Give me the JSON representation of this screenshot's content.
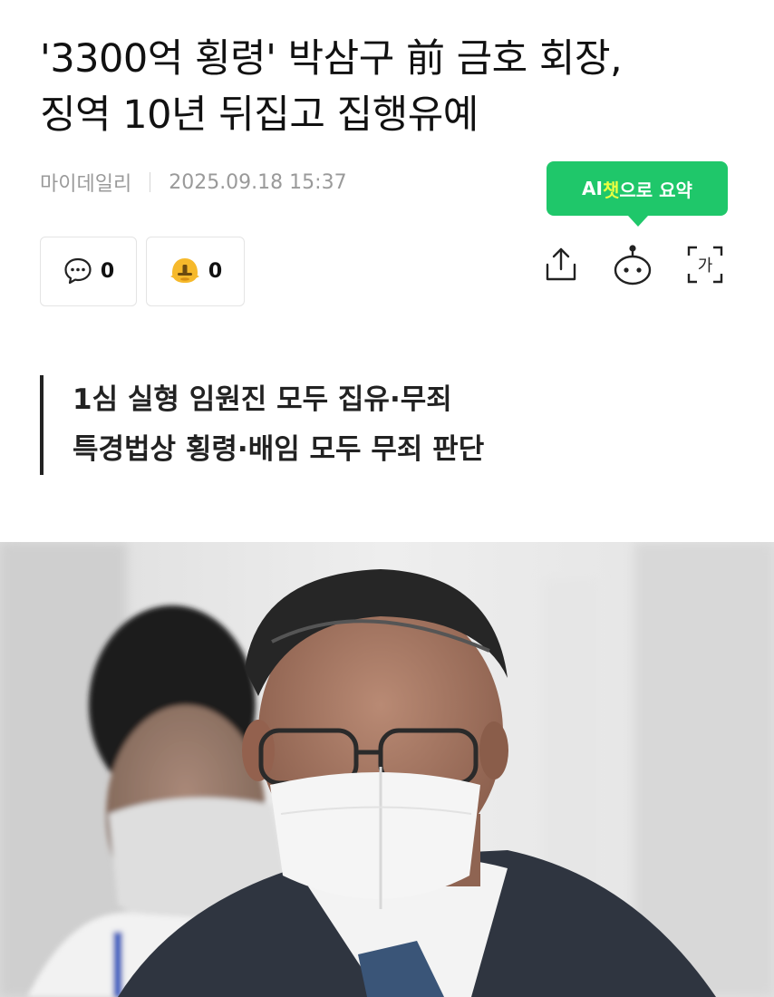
{
  "article": {
    "headline_line1": "'3300억 횡령' 박삼구 前 금호 회장,",
    "headline_line2": "징역 10년 뒤집고 집행유예",
    "source": "마이데일리",
    "datetime": "2025.09.18 15:37"
  },
  "ai_summary": {
    "prefix": "AI",
    "highlight": "챗",
    "suffix": "으로 요약"
  },
  "reactions": {
    "comment_count": "0",
    "emotion_count": "0"
  },
  "toolbar": {
    "share_icon": "share-icon",
    "ai_bot_icon": "chatbot-icon",
    "font_icon": "font-size-icon",
    "font_icon_glyph": "가"
  },
  "subheadline": {
    "line1": "1심 실형 임원진 모두 집유·무죄",
    "line2": "특경법상 횡령·배임 모두 무죄 판단"
  },
  "colors": {
    "accent_green": "#1fc76a",
    "highlight_yellow": "#e9ff40",
    "emotion_yellow": "#f6b92b"
  }
}
